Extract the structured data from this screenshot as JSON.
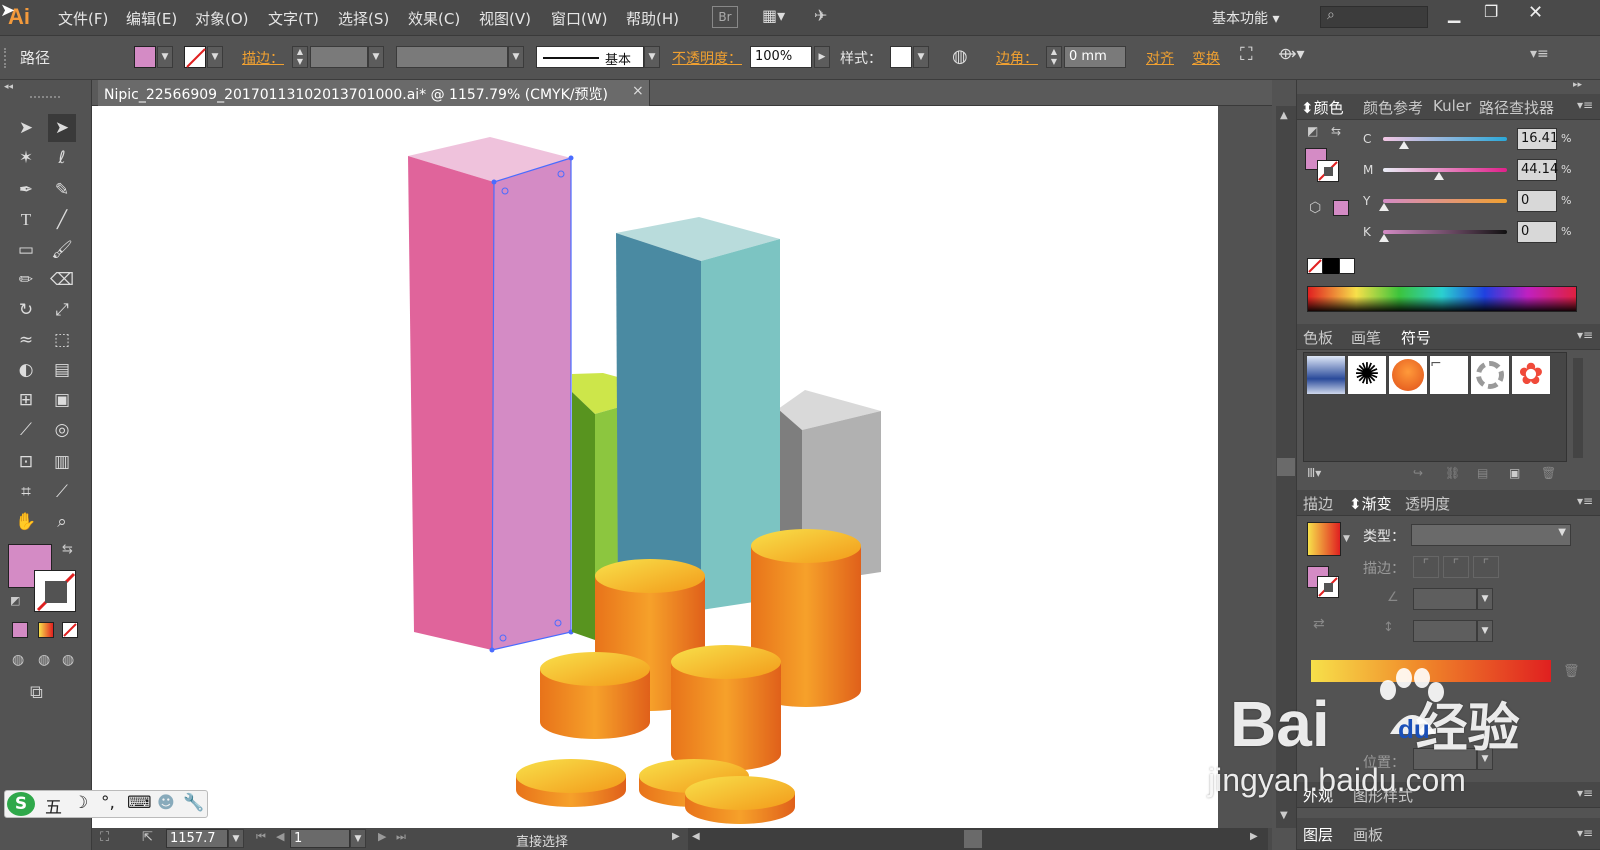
{
  "menubar": {
    "logo": "Ai",
    "items": [
      "文件(F)",
      "编辑(E)",
      "对象(O)",
      "文字(T)",
      "选择(S)",
      "效果(C)",
      "视图(V)",
      "窗口(W)",
      "帮助(H)"
    ],
    "bridge": "Br",
    "workspace": "基本功能"
  },
  "control": {
    "selection": "路径",
    "stroke_label": "描边：",
    "stroke_style": "基本",
    "opacity_label": "不透明度：",
    "opacity_value": "100%",
    "style_label": "样式：",
    "corner_label": "边角：",
    "corner_value": "0 mm",
    "align_label": "对齐",
    "transform_label": "变换"
  },
  "document": {
    "tab_title": "Nipic_22566909_20170113102013701000.ai* @ 1157.79% (CMYK/预览)",
    "close": "×"
  },
  "status": {
    "zoom": "1157.7",
    "page": "1",
    "tool": "直接选择"
  },
  "color_panel": {
    "tabs": [
      "颜色",
      "颜色参考",
      "Kuler",
      "路径查找器"
    ],
    "channels": [
      {
        "name": "C",
        "value": "16.41",
        "pos": 0.164
      },
      {
        "name": "M",
        "value": "44.14",
        "pos": 0.441
      },
      {
        "name": "Y",
        "value": "0",
        "pos": 0.0
      },
      {
        "name": "K",
        "value": "0",
        "pos": 0.0
      }
    ],
    "unit": "%",
    "fill_color": "#d48bc5"
  },
  "symbol_panel": {
    "tabs": [
      "色板",
      "画笔",
      "符号"
    ]
  },
  "gradient_panel": {
    "tabs": [
      "描边",
      "渐变",
      "透明度"
    ],
    "type_label": "类型：",
    "stroke_label": "描边：",
    "position_label": "位置："
  },
  "bottom_tabs": {
    "appearance": [
      "外观",
      "图形样式"
    ],
    "layers": [
      "图层",
      "画板"
    ]
  },
  "watermark": {
    "brand": "Bai",
    "brand_suffix": "经验",
    "du": "du",
    "url": "jingyan.baidu.com"
  },
  "ime": {
    "logo": "S",
    "mode": "五"
  },
  "colors": {
    "accent_orange": "#f0a030",
    "selection_blue": "#4a6cff"
  }
}
